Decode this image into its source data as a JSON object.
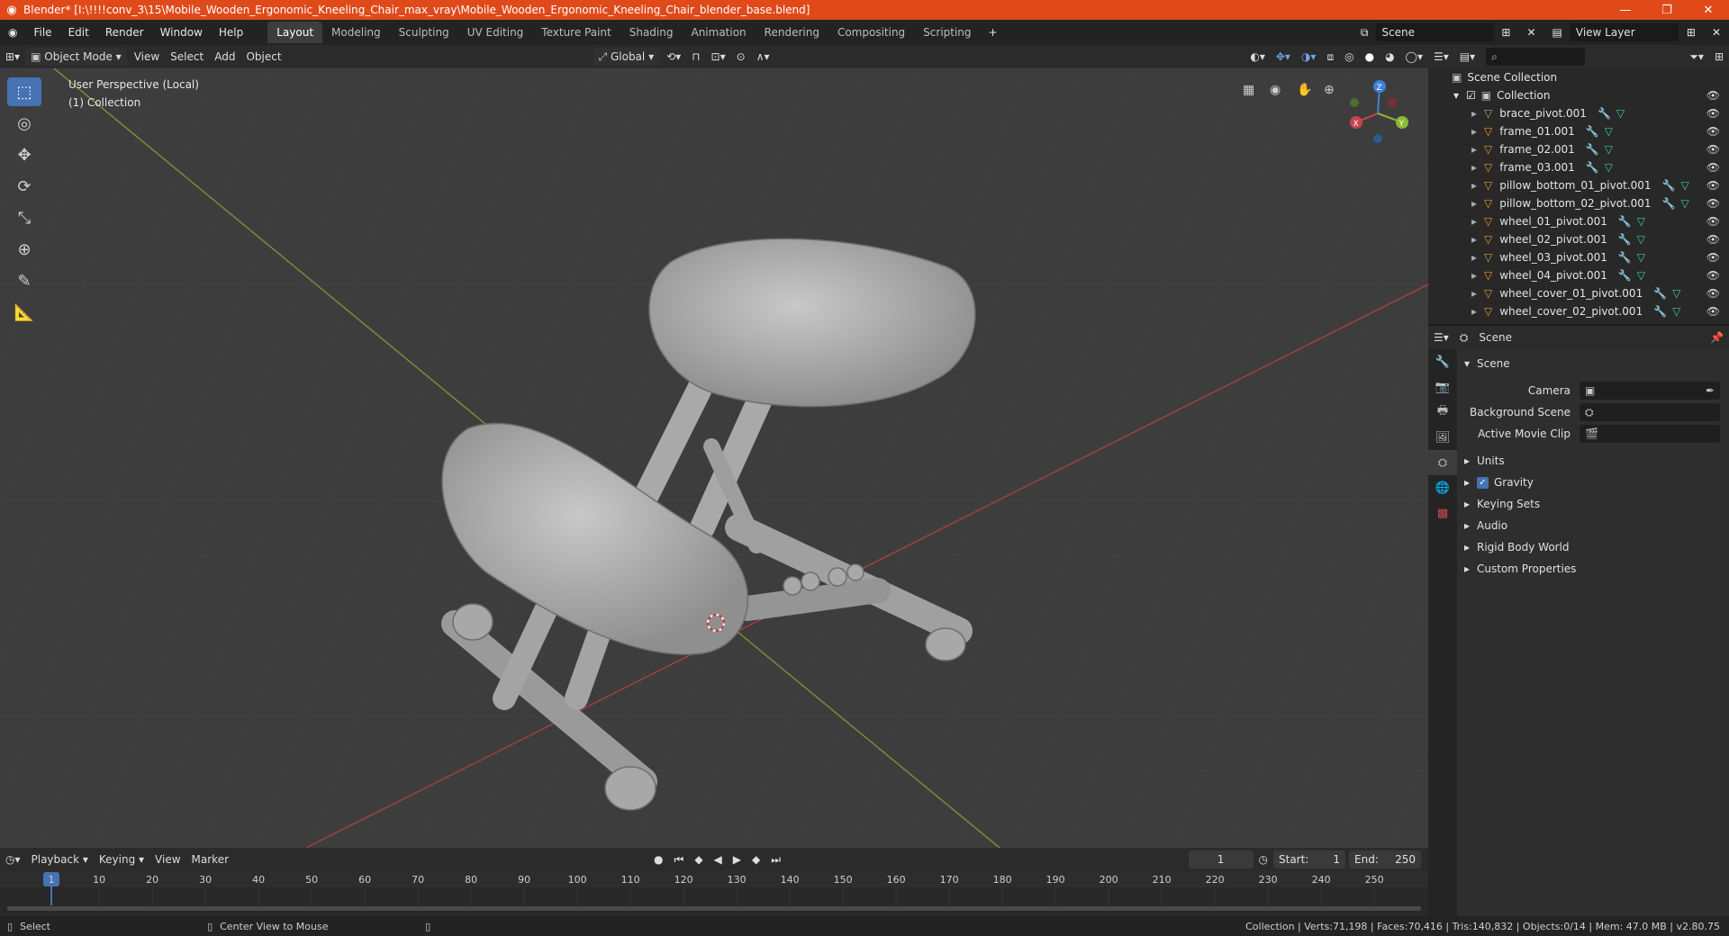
{
  "titlebar": {
    "title": "Blender* [I:\\!!!!conv_3\\15\\Mobile_Wooden_Ergonomic_Kneeling_Chair_max_vray\\Mobile_Wooden_Ergonomic_Kneeling_Chair_blender_base.blend]",
    "minimize": "—",
    "maximize": "❐",
    "close": "✕"
  },
  "menu": [
    "File",
    "Edit",
    "Render",
    "Window",
    "Help"
  ],
  "workspaces": [
    "Layout",
    "Modeling",
    "Sculpting",
    "UV Editing",
    "Texture Paint",
    "Shading",
    "Animation",
    "Rendering",
    "Compositing",
    "Scripting"
  ],
  "active_workspace": "Layout",
  "scene_field": "Scene",
  "viewlayer_field": "View Layer",
  "viewport_header": {
    "mode": "Object Mode",
    "menus": [
      "View",
      "Select",
      "Add",
      "Object"
    ],
    "orientation": "Global"
  },
  "viewport": {
    "perspective": "User Perspective (Local)",
    "collection": "(1) Collection",
    "gizmo_axes": {
      "x": "X",
      "y": "Y",
      "z": "Z"
    }
  },
  "outliner": {
    "root": "Scene Collection",
    "collection": "Collection",
    "items": [
      "brace_pivot.001",
      "frame_01.001",
      "frame_02.001",
      "frame_03.001",
      "pillow_bottom_01_pivot.001",
      "pillow_bottom_02_pivot.001",
      "wheel_01_pivot.001",
      "wheel_02_pivot.001",
      "wheel_03_pivot.001",
      "wheel_04_pivot.001",
      "wheel_cover_01_pivot.001",
      "wheel_cover_02_pivot.001"
    ]
  },
  "properties": {
    "header": "Scene",
    "section": "Scene",
    "fields": [
      {
        "label": "Camera",
        "value": ""
      },
      {
        "label": "Background Scene",
        "value": ""
      },
      {
        "label": "Active Movie Clip",
        "value": ""
      }
    ],
    "panels": [
      "Units",
      "Gravity",
      "Keying Sets",
      "Audio",
      "Rigid Body World",
      "Custom Properties"
    ]
  },
  "timeline": {
    "menus": [
      "Playback",
      "Keying",
      "View",
      "Marker"
    ],
    "current_frame": "1",
    "start_label": "Start:",
    "start": "1",
    "end_label": "End:",
    "end": "250",
    "ticks": [
      "1",
      "10",
      "20",
      "30",
      "40",
      "50",
      "60",
      "70",
      "80",
      "90",
      "100",
      "110",
      "120",
      "130",
      "140",
      "150",
      "160",
      "170",
      "180",
      "190",
      "200",
      "210",
      "220",
      "230",
      "240",
      "250"
    ]
  },
  "statusbar": {
    "left1": "Select",
    "left2": "Center View to Mouse",
    "stats": "Collection | Verts:71,198 | Faces:70,416 | Tris:140,832 | Objects:0/14 | Mem: 47.0 MB | v2.80.75"
  },
  "colors": {
    "accent": "#4772b3",
    "titlebar": "#e04a1b",
    "x_axis": "#c8434c",
    "y_axis": "#8bb934",
    "z_axis": "#3d82d6"
  }
}
